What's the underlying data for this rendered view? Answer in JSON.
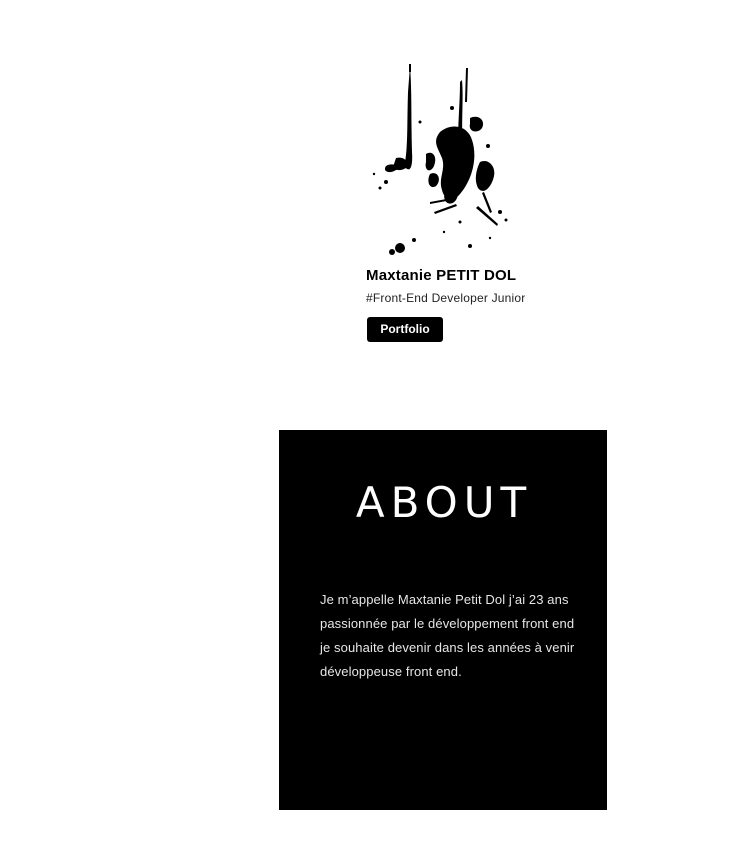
{
  "profile": {
    "image_icon": "ink-splash-illustration",
    "name": "Maxtanie PETIT DOL",
    "role": "#Front-End Developer Junior",
    "button_label": "Portfolio"
  },
  "about": {
    "title": "ABOUT",
    "lines": [
      "Je m’appelle Maxtanie Petit Dol j’ai 23 ans",
      "passionnée par le développement front end",
      "je souhaite devenir dans les années à venir",
      "développeuse front end."
    ]
  },
  "colors": {
    "background": "#ffffff",
    "panel": "#000000",
    "panel_text": "#e6e6e6",
    "button_bg": "#000000",
    "button_text": "#ffffff"
  }
}
